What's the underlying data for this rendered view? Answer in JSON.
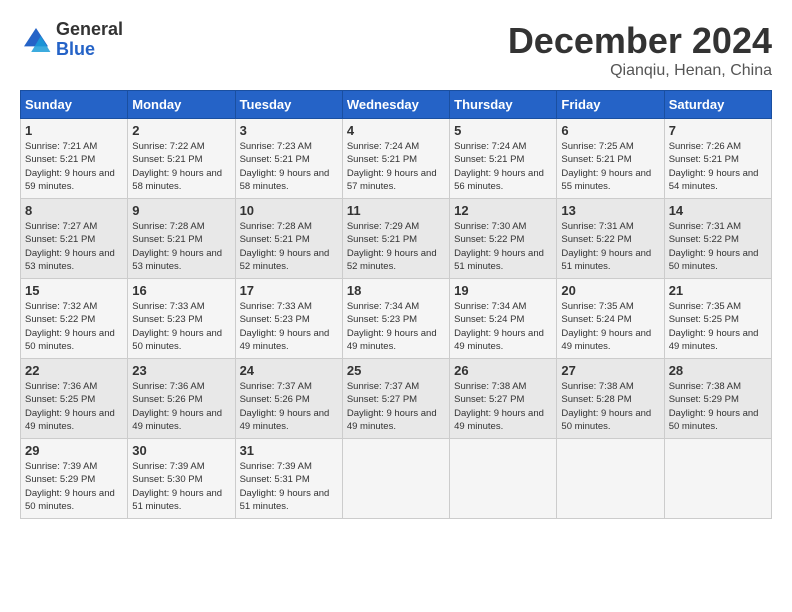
{
  "header": {
    "logo_general": "General",
    "logo_blue": "Blue",
    "month_title": "December 2024",
    "location": "Qianqiu, Henan, China"
  },
  "days_of_week": [
    "Sunday",
    "Monday",
    "Tuesday",
    "Wednesday",
    "Thursday",
    "Friday",
    "Saturday"
  ],
  "weeks": [
    [
      {
        "day": 1,
        "sunrise": "7:21 AM",
        "sunset": "5:21 PM",
        "daylight": "9 hours and 59 minutes."
      },
      {
        "day": 2,
        "sunrise": "7:22 AM",
        "sunset": "5:21 PM",
        "daylight": "9 hours and 58 minutes."
      },
      {
        "day": 3,
        "sunrise": "7:23 AM",
        "sunset": "5:21 PM",
        "daylight": "9 hours and 58 minutes."
      },
      {
        "day": 4,
        "sunrise": "7:24 AM",
        "sunset": "5:21 PM",
        "daylight": "9 hours and 57 minutes."
      },
      {
        "day": 5,
        "sunrise": "7:24 AM",
        "sunset": "5:21 PM",
        "daylight": "9 hours and 56 minutes."
      },
      {
        "day": 6,
        "sunrise": "7:25 AM",
        "sunset": "5:21 PM",
        "daylight": "9 hours and 55 minutes."
      },
      {
        "day": 7,
        "sunrise": "7:26 AM",
        "sunset": "5:21 PM",
        "daylight": "9 hours and 54 minutes."
      }
    ],
    [
      {
        "day": 8,
        "sunrise": "7:27 AM",
        "sunset": "5:21 PM",
        "daylight": "9 hours and 53 minutes."
      },
      {
        "day": 9,
        "sunrise": "7:28 AM",
        "sunset": "5:21 PM",
        "daylight": "9 hours and 53 minutes."
      },
      {
        "day": 10,
        "sunrise": "7:28 AM",
        "sunset": "5:21 PM",
        "daylight": "9 hours and 52 minutes."
      },
      {
        "day": 11,
        "sunrise": "7:29 AM",
        "sunset": "5:21 PM",
        "daylight": "9 hours and 52 minutes."
      },
      {
        "day": 12,
        "sunrise": "7:30 AM",
        "sunset": "5:22 PM",
        "daylight": "9 hours and 51 minutes."
      },
      {
        "day": 13,
        "sunrise": "7:31 AM",
        "sunset": "5:22 PM",
        "daylight": "9 hours and 51 minutes."
      },
      {
        "day": 14,
        "sunrise": "7:31 AM",
        "sunset": "5:22 PM",
        "daylight": "9 hours and 50 minutes."
      }
    ],
    [
      {
        "day": 15,
        "sunrise": "7:32 AM",
        "sunset": "5:22 PM",
        "daylight": "9 hours and 50 minutes."
      },
      {
        "day": 16,
        "sunrise": "7:33 AM",
        "sunset": "5:23 PM",
        "daylight": "9 hours and 50 minutes."
      },
      {
        "day": 17,
        "sunrise": "7:33 AM",
        "sunset": "5:23 PM",
        "daylight": "9 hours and 49 minutes."
      },
      {
        "day": 18,
        "sunrise": "7:34 AM",
        "sunset": "5:23 PM",
        "daylight": "9 hours and 49 minutes."
      },
      {
        "day": 19,
        "sunrise": "7:34 AM",
        "sunset": "5:24 PM",
        "daylight": "9 hours and 49 minutes."
      },
      {
        "day": 20,
        "sunrise": "7:35 AM",
        "sunset": "5:24 PM",
        "daylight": "9 hours and 49 minutes."
      },
      {
        "day": 21,
        "sunrise": "7:35 AM",
        "sunset": "5:25 PM",
        "daylight": "9 hours and 49 minutes."
      }
    ],
    [
      {
        "day": 22,
        "sunrise": "7:36 AM",
        "sunset": "5:25 PM",
        "daylight": "9 hours and 49 minutes."
      },
      {
        "day": 23,
        "sunrise": "7:36 AM",
        "sunset": "5:26 PM",
        "daylight": "9 hours and 49 minutes."
      },
      {
        "day": 24,
        "sunrise": "7:37 AM",
        "sunset": "5:26 PM",
        "daylight": "9 hours and 49 minutes."
      },
      {
        "day": 25,
        "sunrise": "7:37 AM",
        "sunset": "5:27 PM",
        "daylight": "9 hours and 49 minutes."
      },
      {
        "day": 26,
        "sunrise": "7:38 AM",
        "sunset": "5:27 PM",
        "daylight": "9 hours and 49 minutes."
      },
      {
        "day": 27,
        "sunrise": "7:38 AM",
        "sunset": "5:28 PM",
        "daylight": "9 hours and 50 minutes."
      },
      {
        "day": 28,
        "sunrise": "7:38 AM",
        "sunset": "5:29 PM",
        "daylight": "9 hours and 50 minutes."
      }
    ],
    [
      {
        "day": 29,
        "sunrise": "7:39 AM",
        "sunset": "5:29 PM",
        "daylight": "9 hours and 50 minutes."
      },
      {
        "day": 30,
        "sunrise": "7:39 AM",
        "sunset": "5:30 PM",
        "daylight": "9 hours and 51 minutes."
      },
      {
        "day": 31,
        "sunrise": "7:39 AM",
        "sunset": "5:31 PM",
        "daylight": "9 hours and 51 minutes."
      },
      null,
      null,
      null,
      null
    ]
  ]
}
